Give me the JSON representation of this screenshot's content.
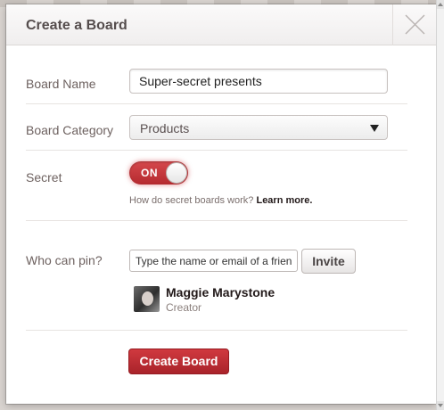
{
  "dialog": {
    "title": "Create a Board"
  },
  "form": {
    "board_name": {
      "label": "Board Name",
      "value": "Super-secret presents"
    },
    "board_category": {
      "label": "Board Category",
      "value": "Products"
    },
    "secret": {
      "label": "Secret",
      "toggle_label": "ON",
      "help_text": "How do secret boards work?",
      "help_link": "Learn more."
    },
    "who_can_pin": {
      "label": "Who can pin?",
      "placeholder": "Type the name or email of a friend.",
      "invite_label": "Invite"
    },
    "collaborator": {
      "name": "Maggie Marystone",
      "role": "Creator"
    },
    "submit_label": "Create Board"
  },
  "colors": {
    "accent": "#c8303a",
    "label_text": "#6e6260"
  }
}
